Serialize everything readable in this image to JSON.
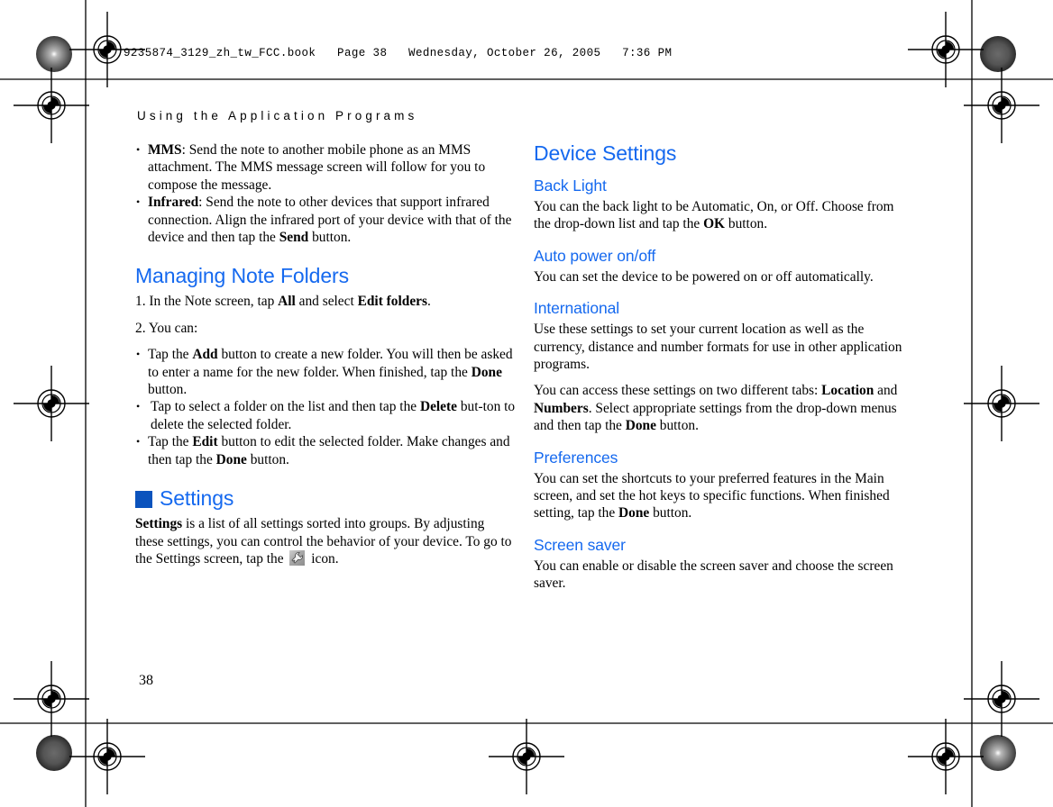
{
  "page": {
    "book_info": "9235874_3129_zh_tw_FCC.book   Page 38   Wednesday, October 26, 2005   7:36 PM",
    "running_head": "Using the Application Programs",
    "folio": "38",
    "accent_blue": "#1569ef",
    "marker_blue": "#0b53bd"
  },
  "left_column": {
    "top_bullets": [
      {
        "term": "MMS",
        "text": ": Send the note to another mobile phone as an MMS attachment. The MMS message screen will follow for you to compose the message."
      },
      {
        "term": "Infrared",
        "text_before": ": Send the note to other devices that support infrared connection. Align the infrared port of your device with that of the device and then tap the ",
        "emphasis": "Send",
        "text_after": " button."
      }
    ],
    "managing_heading": "Managing Note Folders",
    "steps": [
      {
        "lead": "1. In the Note screen, tap ",
        "bold1": "All",
        "mid": " and select ",
        "bold2": "Edit folders",
        "tail": "."
      },
      {
        "lead": "2. You can:"
      }
    ],
    "folder_bullets": [
      {
        "lead": "Tap the ",
        "bold1": "Add",
        "mid": " button to create a new folder. You will then be asked to enter a name for the new folder. When finished, tap the ",
        "bold2": "Done",
        "tail": " button."
      },
      {
        "lead": "Tap to select a folder on the list and then tap the ",
        "bold1": "Delete",
        "mid": " but-ton to delete the selected folder.",
        "bold2": "",
        "tail": ""
      },
      {
        "lead": "Tap the ",
        "bold1": "Edit",
        "mid": " button to edit the selected folder. Make changes and then tap the ",
        "bold2": "Done",
        "tail": " button."
      }
    ],
    "settings_heading": "Settings",
    "settings_para": {
      "bold1": "Settings",
      "text1": " is a list of all settings sorted into groups. By adjusting these settings, you can control the behavior of your device. To go to the Settings screen, tap the ",
      "icon": "wrench-icon",
      "text2": " icon."
    }
  },
  "right_column": {
    "device_settings_heading": "Device Settings",
    "sections": [
      {
        "heading": "Back Light",
        "lead": "You can the back light to be Automatic, On, or Off. Choose from the drop-down list and tap the ",
        "bold": "OK",
        "tail": " button."
      },
      {
        "heading": "Auto power on/off",
        "lead": "You can set the device to be powered on or off automatically.",
        "bold": "",
        "tail": ""
      },
      {
        "heading": "International",
        "lead": "Use these settings to set your current location as well as the currency, distance and number formats for use in other application programs.",
        "bold": "",
        "tail": ""
      },
      {
        "heading": "Preferences",
        "lead": "You can set the shortcuts to your preferred features in the Main screen, and set the hot keys to specific functions. When finished setting, tap the ",
        "bold": "Done",
        "tail": " button."
      },
      {
        "heading": "Screen saver",
        "lead": "You can enable or disable the screen saver and choose the screen saver.",
        "bold": "",
        "tail": ""
      }
    ],
    "international_extra": {
      "lead": "You can access these settings on two different tabs: ",
      "bold1": "Location",
      "mid": " and ",
      "bold2": "Numbers",
      "tail": ". Select appropriate settings from the drop-down menus and then tap the ",
      "bold3": "Done",
      "end": " button."
    }
  }
}
